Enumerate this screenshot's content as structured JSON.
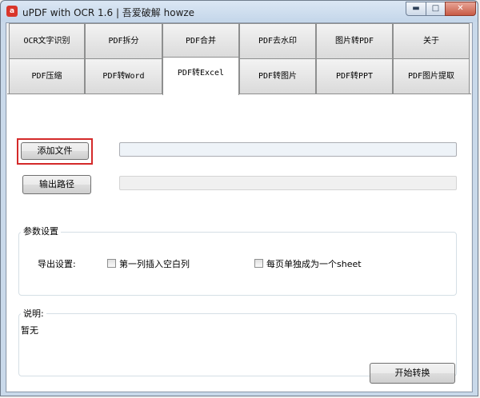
{
  "window": {
    "title": "uPDF with OCR 1.6 | 吾爱破解 howze",
    "app_icon_glyph": "a",
    "min_glyph": "▬",
    "max_glyph": "□",
    "close_glyph": "✕"
  },
  "tabs": {
    "row1": [
      "OCR文字识别",
      "PDF拆分",
      "PDF合并",
      "PDF去水印",
      "图片转PDF",
      "关于"
    ],
    "row2": [
      "PDF压缩",
      "PDF转Word",
      "PDF转Excel",
      "PDF转图片",
      "PDF转PPT",
      "PDF图片提取"
    ],
    "active": "PDF转Excel"
  },
  "panel": {
    "add_file_label": "添加文件",
    "add_file_value": "",
    "output_path_label": "输出路径",
    "output_path_value": "",
    "params": {
      "title": "参数设置",
      "export_label": "导出设置:",
      "option1": "第一列插入空白列",
      "option1_checked": false,
      "option2": "每页单独成为一个sheet",
      "option2_checked": false
    },
    "notes": {
      "title": "说明:",
      "text": "暂无"
    },
    "start_label": "开始转换"
  },
  "colors": {
    "focus_ring": "#d42a2a",
    "close_button": "#c85b45"
  }
}
